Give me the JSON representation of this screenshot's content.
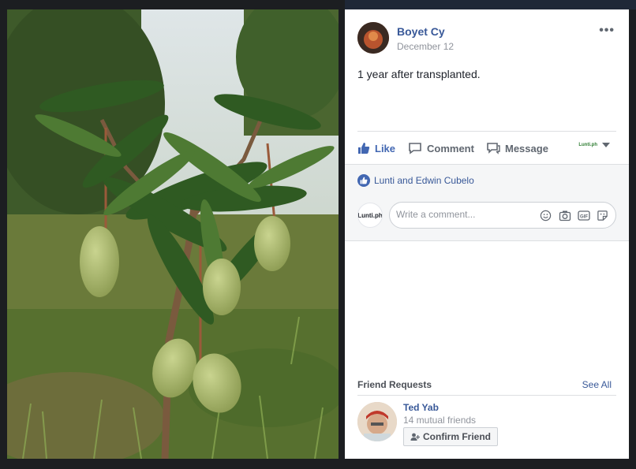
{
  "photo": {
    "description_alt": ""
  },
  "post": {
    "author": "Boyet Cy",
    "date": "December 12",
    "more_label": "•••",
    "text": "1 year after transplanted."
  },
  "actions": {
    "like_label": "Like",
    "comment_label": "Comment",
    "message_label": "Message",
    "page_logo": "Lunti.ph"
  },
  "reactions": {
    "reactors": "Lunti and Edwin Cubelo"
  },
  "comment": {
    "placeholder": "Write a comment...",
    "page_avatar_label": "Lunti.ph"
  },
  "friend_requests": {
    "title": "Friend Requests",
    "see_all": "See All",
    "items": [
      {
        "name": "Ted Yab",
        "mutual": "14 mutual friends",
        "confirm_label": "Confirm Friend"
      }
    ]
  },
  "colors": {
    "link": "#385898",
    "like_blue": "#4267b2",
    "text": "#1d2129",
    "muted": "#90949c"
  }
}
